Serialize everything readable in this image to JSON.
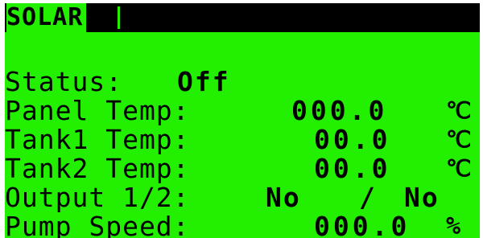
{
  "screen": {
    "title": "SOLAR",
    "status_label": "Status:",
    "status_value": "Off",
    "panel_temp_label": "Panel Temp:",
    "panel_temp_value": "000.0",
    "panel_temp_unit": "℃",
    "tank1_temp_label": "Tank1 Temp:",
    "tank1_temp_value": "00.0",
    "tank1_temp_unit": "℃",
    "tank2_temp_label": "Tank2 Temp:",
    "tank2_temp_value": "00.0",
    "tank2_temp_unit": "℃",
    "output_label": "Output 1/2:",
    "output1_value": "No",
    "output_separator": "/",
    "output2_value": "No",
    "pump_speed_label": "Pump Speed:",
    "pump_speed_value": "000.0",
    "pump_speed_unit": "%"
  },
  "colors": {
    "lcd_background": "#22f000",
    "lcd_foreground": "#000000"
  }
}
